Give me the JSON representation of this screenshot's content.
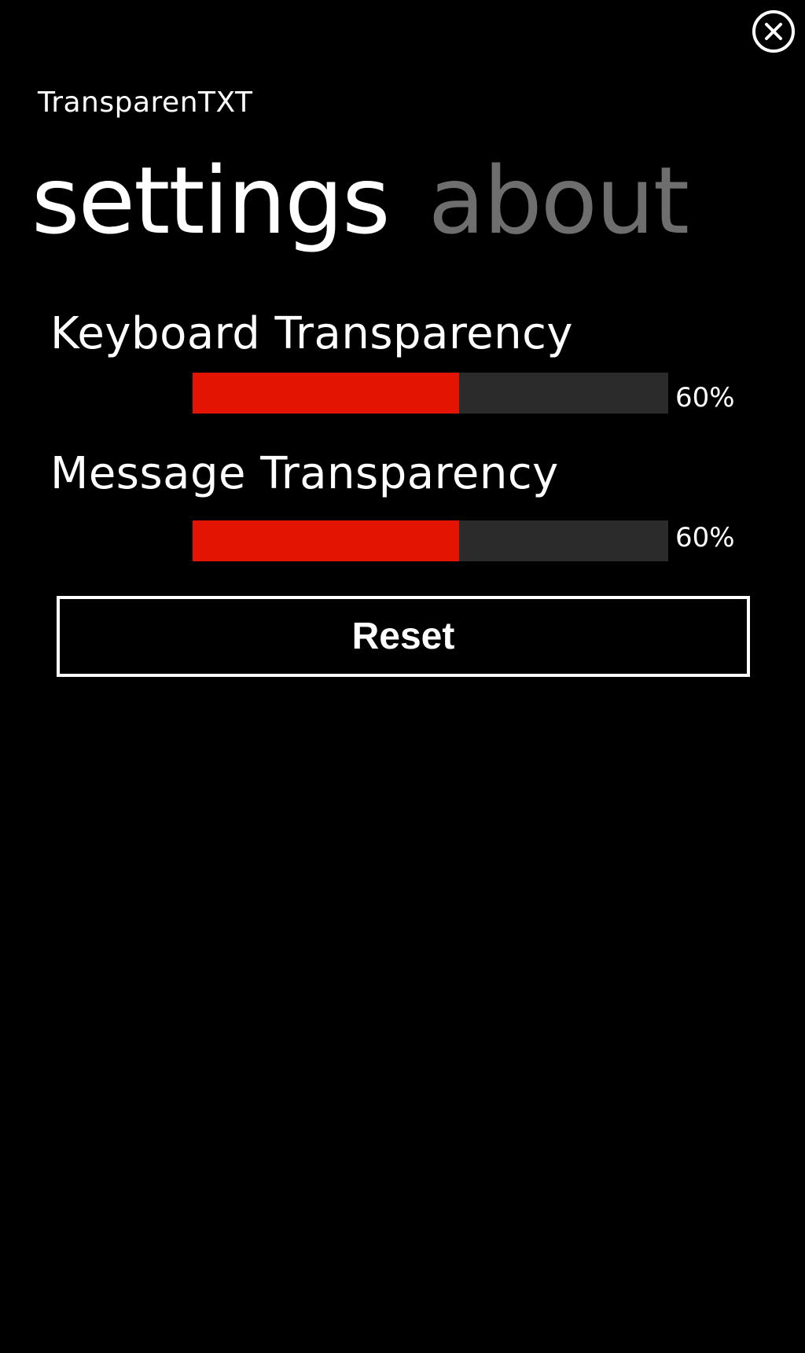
{
  "app": {
    "title": "TransparenTXT"
  },
  "pivot": {
    "tabs": [
      {
        "label": "settings",
        "active": true
      },
      {
        "label": "about",
        "active": false
      }
    ]
  },
  "settings": {
    "keyboard": {
      "label": "Keyboard Transparency",
      "value_text": "60%",
      "fraction": 0.56
    },
    "message": {
      "label": "Message Transparency",
      "value_text": "60%",
      "fraction": 0.56
    },
    "reset_label": "Reset"
  },
  "icons": {
    "close": "close-icon"
  },
  "colors": {
    "background": "#000000",
    "accent": "#e31502",
    "track": "#2b2b2b",
    "inactive_tab": "#6e6e6e"
  }
}
